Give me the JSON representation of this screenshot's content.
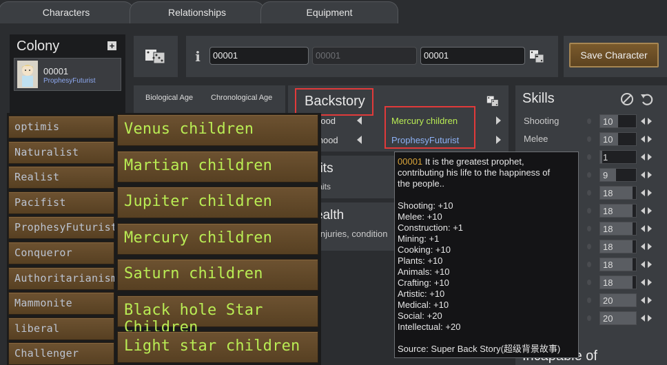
{
  "tabs": [
    "Characters",
    "Relationships",
    "Equipment"
  ],
  "colony": {
    "title": "Colony",
    "add_label": "+",
    "pawn": {
      "name": "00001",
      "title": "ProphesyFuturist"
    }
  },
  "name_fields": {
    "first": "00001",
    "nick_placeholder": "00001",
    "last": "00001"
  },
  "save_label": "Save Character",
  "age": {
    "bio_label": "Biological Age",
    "chrono_label": "Chronological Age"
  },
  "backstory": {
    "title": "Backstory",
    "childhood_label": "ldhood",
    "adulthood_label": "althood",
    "childhood_value": "Mercury children",
    "adulthood_value": "ProphesyFuturist"
  },
  "traits": {
    "title": "aits",
    "sub": "traits"
  },
  "health": {
    "title": "ealth",
    "sub": "injuries, condition"
  },
  "skills": {
    "title": "Skills",
    "items": [
      {
        "label": "Shooting",
        "value": "10"
      },
      {
        "label": "Melee",
        "value": "10"
      },
      {
        "label": "",
        "value": "1"
      },
      {
        "label": "",
        "value": "9"
      },
      {
        "label": "",
        "value": "18"
      },
      {
        "label": "",
        "value": "18"
      },
      {
        "label": "",
        "value": "18"
      },
      {
        "label": "",
        "value": "18"
      },
      {
        "label": "",
        "value": "18"
      },
      {
        "label": "",
        "value": "18"
      },
      {
        "label": "",
        "value": "20"
      },
      {
        "label": "",
        "value": "20"
      }
    ],
    "incapable": "Incapable of"
  },
  "adulthood_menu": [
    "optimis",
    "Naturalist",
    "Realist",
    "Pacifist",
    "ProphesyFuturist",
    "Conqueror",
    "Authoritarianism",
    "Mammonite",
    "liberal",
    "Challenger"
  ],
  "childhood_menu": [
    "Venus children",
    "Martian children",
    "Jupiter children",
    "Mercury children",
    "Saturn children",
    "Black hole Star Children",
    "Light star children"
  ],
  "tooltip": {
    "id": "00001",
    "desc1": " It is the greatest prophet,",
    "desc2": "contributing his life to the happiness of",
    "desc3": "the people..",
    "stats": [
      "Shooting: +10",
      "Melee: +10",
      "Construction: +1",
      "Mining: +1",
      "Cooking: +10",
      "Plants: +10",
      "Animals: +10",
      "Crafting: +10",
      "Artistic: +10",
      "Medical: +10",
      "Social: +20",
      "Intellectual: +20"
    ],
    "source": "Source: Super Back Story(超级背景故事)"
  },
  "colors": {
    "accent_green": "#b9ec54",
    "accent_blue": "#8db1f5",
    "highlight_red": "#e23a3a",
    "button_brown": "#6d5231"
  }
}
